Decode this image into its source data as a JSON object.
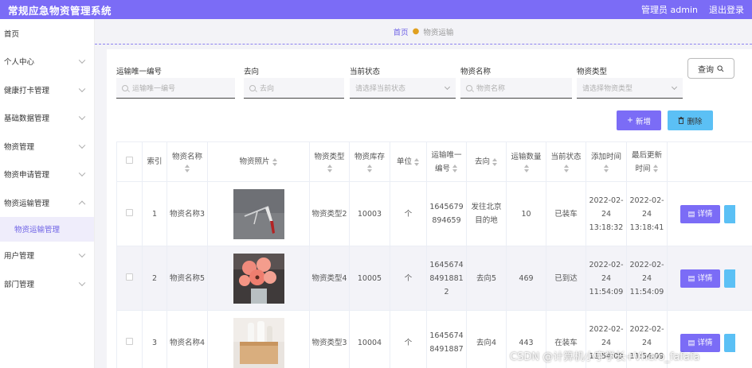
{
  "header": {
    "title": "常规应急物资管理系统",
    "user": "管理员 admin",
    "logout": "退出登录"
  },
  "sidebar": {
    "items": [
      {
        "label": "首页",
        "chevron": "none"
      },
      {
        "label": "个人中心",
        "chevron": "down"
      },
      {
        "label": "健康打卡管理",
        "chevron": "down"
      },
      {
        "label": "基础数据管理",
        "chevron": "down"
      },
      {
        "label": "物资管理",
        "chevron": "down"
      },
      {
        "label": "物资申请管理",
        "chevron": "down"
      },
      {
        "label": "物资运输管理",
        "chevron": "up"
      }
    ],
    "active_sub": "物资运输管理",
    "items_after": [
      {
        "label": "用户管理",
        "chevron": "down"
      },
      {
        "label": "部门管理",
        "chevron": "down"
      }
    ]
  },
  "breadcrumb": {
    "home": "首页",
    "current": "物资运输"
  },
  "filters": {
    "code": {
      "label": "运输唯一编号",
      "placeholder": "运输唯一编号"
    },
    "dest": {
      "label": "去向",
      "placeholder": "去向"
    },
    "status": {
      "label": "当前状态",
      "placeholder": "请选择当前状态"
    },
    "name": {
      "label": "物资名称",
      "placeholder": "物资名称"
    },
    "type": {
      "label": "物资类型",
      "placeholder": "请选择物资类型"
    }
  },
  "buttons": {
    "query": "查询",
    "add": "新增",
    "delete": "删除",
    "detail": "详情"
  },
  "table": {
    "headers": {
      "index": "索引",
      "name": "物资名称",
      "photo": "物资照片",
      "type": "物资类型",
      "stock": "物资库存",
      "unit": "单位",
      "code": "运输唯一编号",
      "dest": "去向",
      "qty": "运输数量",
      "status": "当前状态",
      "added": "添加时间",
      "updated": "最后更新时间"
    },
    "rows": [
      {
        "index": "1",
        "name": "物资名称3",
        "photo": "tool-photo",
        "type": "物资类型2",
        "stock": "10003",
        "unit": "个",
        "code": "1645679894659",
        "dest": "发往北京目的地",
        "qty": "10",
        "status": "已装车",
        "added": "2022-02-24 13:18:32",
        "updated": "2022-02-24 13:18:41"
      },
      {
        "index": "2",
        "name": "物资名称5",
        "photo": "flower-photo",
        "type": "物资类型4",
        "stock": "10005",
        "unit": "个",
        "code": "16456748491881 2",
        "dest": "去向5",
        "qty": "469",
        "status": "已到达",
        "added": "2022-02-24 11:54:09",
        "updated": "2022-02-24 11:54:09"
      },
      {
        "index": "3",
        "name": "物资名称4",
        "photo": "box-photo",
        "type": "物资类型3",
        "stock": "10004",
        "unit": "个",
        "code": "16456748491887",
        "dest": "去向4",
        "qty": "443",
        "status": "在装车",
        "added": "2022-02-24 11:54:09",
        "updated": "2022-02-24 11:54:09"
      }
    ]
  },
  "watermark": "CSDN @计算机小宇学长+Vhero_fafafa",
  "colors": {
    "accent": "#7b6cf6",
    "info": "#5bc0f5"
  }
}
